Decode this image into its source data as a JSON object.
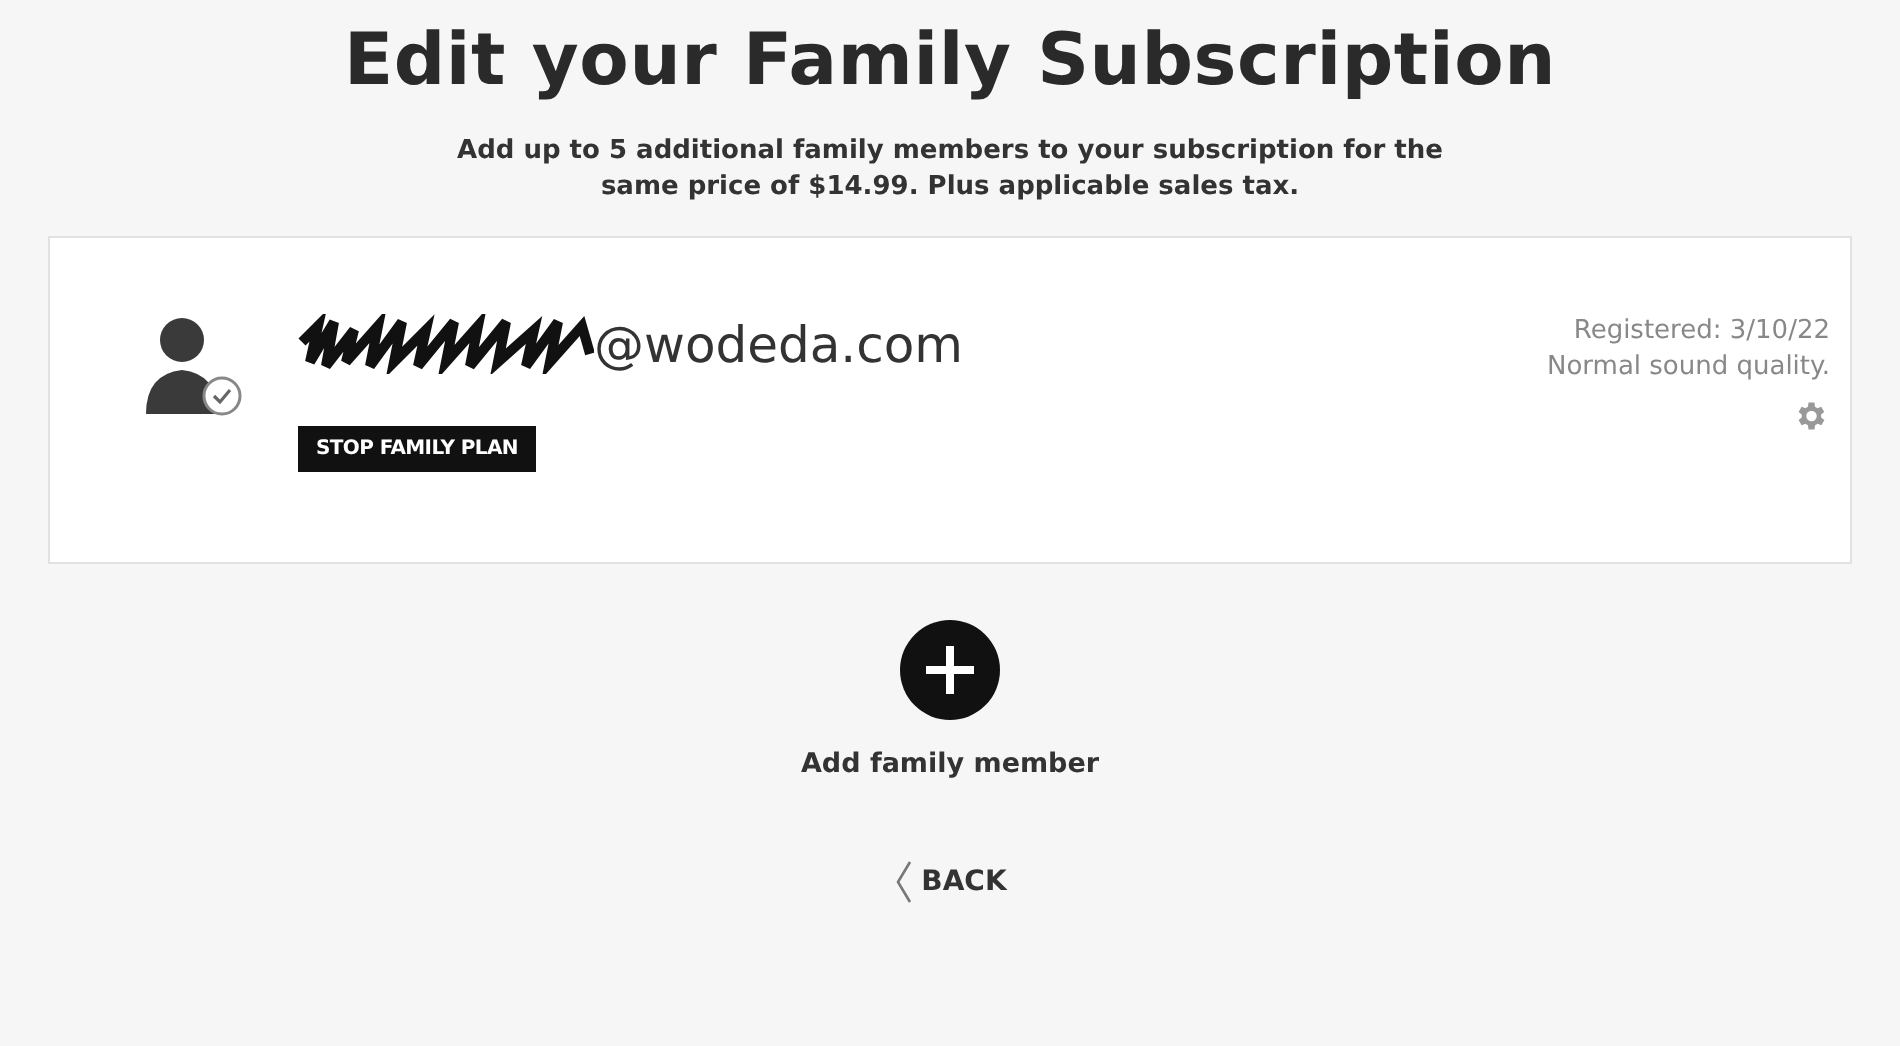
{
  "title": "Edit your Family Subscription",
  "subtitle": "Add up to 5 additional family members to your subscription for the same price of $14.99. Plus applicable sales tax.",
  "members": [
    {
      "email_visible": "@wodeda.com",
      "redacted": true,
      "verified": true,
      "stop_button": "STOP FAMILY PLAN",
      "registered": "Registered: 3/10/22",
      "quality": "Normal sound quality."
    }
  ],
  "add_label": "Add family member",
  "back_label": "BACK"
}
